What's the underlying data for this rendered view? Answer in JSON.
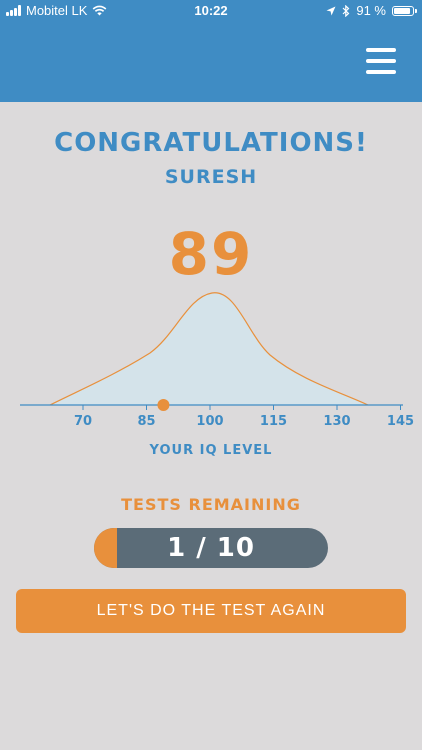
{
  "status_bar": {
    "carrier": "Mobitel LK",
    "time": "10:22",
    "battery": "91 %",
    "battery_level": 0.91,
    "icons": [
      "signal-icon",
      "wifi-icon",
      "location-icon",
      "bluetooth-icon",
      "battery-icon"
    ]
  },
  "header": {
    "menu_icon": "hamburger-menu-icon",
    "background": "#3f8cc4"
  },
  "result": {
    "title": "CONGRATULATIONS!",
    "user_name": "SURESH",
    "score": "89"
  },
  "chart_data": {
    "type": "area",
    "x_ticks": [
      "70",
      "85",
      "100",
      "115",
      "130",
      "145"
    ],
    "distribution": "normal curve centred at 100",
    "marker_value": 89,
    "xlabel": "YOUR IQ LEVEL",
    "colors": {
      "curve": "#e8903c",
      "fill": "#d4e3ea",
      "axis": "#3f8cc4",
      "marker": "#e8903c"
    }
  },
  "tests": {
    "label": "TESTS REMAINING",
    "progress_text": "1 / 10",
    "completed": 1,
    "total": 10
  },
  "actions": {
    "again_label": "LET'S DO THE TEST AGAIN"
  },
  "colors": {
    "primary": "#3f8cc4",
    "accent": "#e8903c",
    "background": "#dcdadb",
    "progress_track": "#5b6c78"
  }
}
